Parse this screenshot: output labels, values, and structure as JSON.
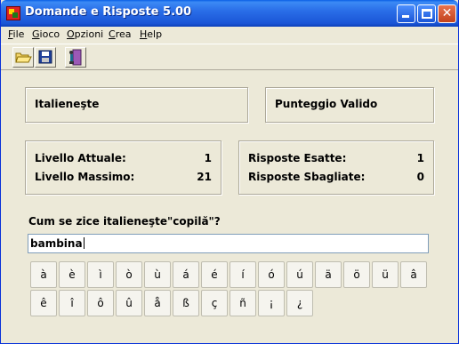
{
  "window": {
    "title": "Domande e Risposte 5.00"
  },
  "menu": [
    {
      "pre": "",
      "u": "F",
      "post": "ile"
    },
    {
      "pre": "",
      "u": "G",
      "post": "ioco"
    },
    {
      "pre": "",
      "u": "O",
      "post": "pzioni"
    },
    {
      "pre": "",
      "u": "C",
      "post": "rea"
    },
    {
      "pre": "",
      "u": "H",
      "post": "elp"
    }
  ],
  "toolbar": [
    "open-folder-icon",
    "save-disk-icon",
    "exit-door-icon"
  ],
  "language_label": "Italieneşte",
  "scoring_label": "Punteggio Valido",
  "levels": {
    "current_label": "Livello Attuale:",
    "current_value": "1",
    "max_label": "Livello Massimo:",
    "max_value": "21"
  },
  "answers": {
    "correct_label": "Risposte Esatte:",
    "correct_value": "1",
    "wrong_label": "Risposte Sbagliate:",
    "wrong_value": "0"
  },
  "question": "Cum se zice italieneşte\"copilă\"?",
  "answer_value": "bambina",
  "special_chars_row1": [
    "à",
    "è",
    "ì",
    "ò",
    "ù",
    "á",
    "é",
    "í",
    "ó",
    "ú",
    "ä",
    "ö",
    "ü",
    "â"
  ],
  "special_chars_row2": [
    "ê",
    "î",
    "ô",
    "û",
    "å",
    "ß",
    "ç",
    "ñ",
    "¡",
    "¿"
  ]
}
